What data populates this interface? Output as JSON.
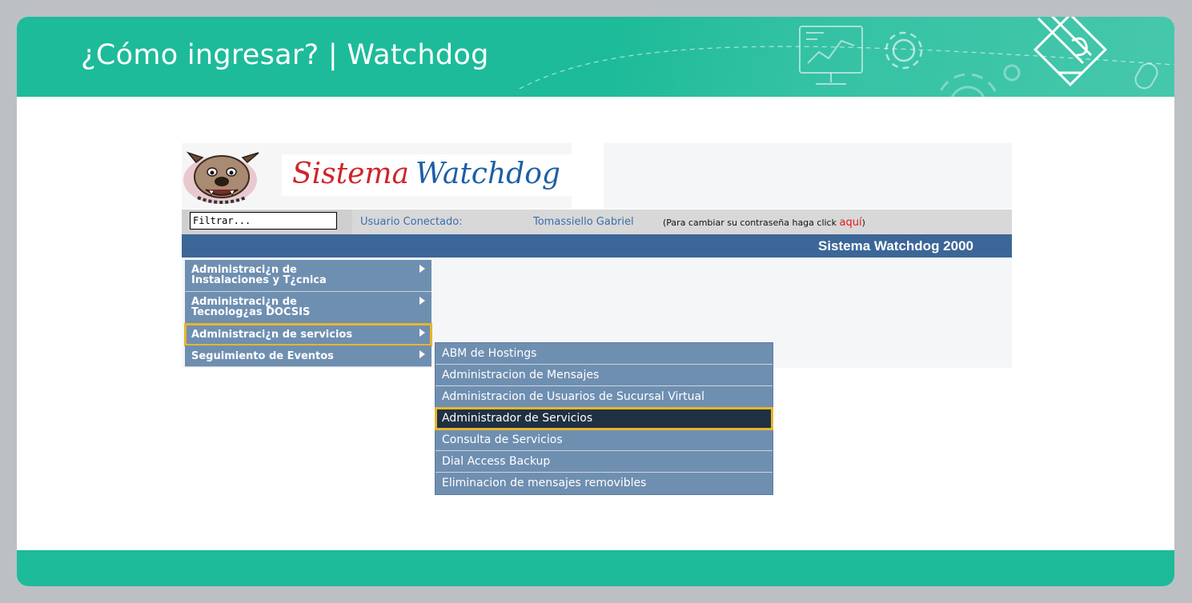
{
  "slide": {
    "title": "¿Cómo ingresar? | Watchdog",
    "accent_color": "#1dbb99",
    "highlight_color": "#e7b52c",
    "decor_icons": [
      "monitor-chart-icon",
      "gear-icon",
      "gear-large-icon",
      "pencil-diamond-icon",
      "mouse-icon"
    ]
  },
  "app": {
    "logo": {
      "word1": "Sistema",
      "word2": "Watchdog",
      "mascot": "bulldog-icon"
    },
    "userbar": {
      "filter_placeholder": "Filtrar...",
      "user_label": "Usuario Conectado:",
      "user_name": "Tomassiello Gabriel",
      "password_prefix": "(Para cambiar su contraseña haga click",
      "password_link": "aquí",
      "password_suffix": ")"
    },
    "system_title": "Sistema Watchdog 2000",
    "menu": [
      {
        "line1": "Administraci¿n de",
        "line2": "Instalaciones y T¿cnica"
      },
      {
        "line1": "Administraci¿n de",
        "line2": "Tecnolog¿as DOCSIS"
      },
      {
        "line1": "Administraci¿n de servicios",
        "line2": ""
      },
      {
        "line1": "Seguimiento de Eventos",
        "line2": ""
      }
    ],
    "submenu": [
      "ABM de Hostings",
      "Administracion de Mensajes",
      "Administracion de Usuarios de Sucursal Virtual",
      "Administrador de Servicios",
      "Consulta de Servicios",
      "Dial Access Backup",
      "Eliminacion de mensajes removibles"
    ]
  }
}
